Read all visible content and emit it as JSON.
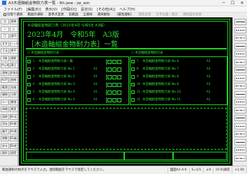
{
  "window": {
    "title": "A3木造軸組金物耐力表一覧 - Rh.jww - jw_win",
    "minimize": "─",
    "maximize": "☐",
    "close": "✕"
  },
  "menu": [
    "ファイル(F)",
    "[編集(E)]",
    "表示(V)",
    "[作図(D)]",
    "設定(S)",
    "[その他(A)]",
    "ヘルプ(H)"
  ],
  "toolbar": {
    "check_label": "切取り選択",
    "items": [
      "範囲外選択",
      "基準点変更",
      "前範囲",
      "全選択",
      "選択解除",
      "〈属性選択〉",
      "属性変更",
      "文字位置・集計",
      "選択図形登録"
    ]
  },
  "left_tools": [
    "点",
    "接線",
    "/",
    "□",
    "〇",
    "接円",
    "文字",
    "ハッチ",
    "寸法",
    "建平",
    "2線",
    "建断",
    "中心線",
    "建立",
    "連線",
    "多角形",
    "AUTO",
    "曲線",
    "範囲",
    "包絡",
    "複線",
    "分割",
    "コーナー",
    "整理",
    "伸縮",
    "属変",
    "面取",
    "BL化",
    "消去",
    "BL解",
    "複写",
    "BL属",
    "移動",
    "BL編",
    "戻る",
    "BL終",
    "図形",
    "図登"
  ],
  "drawing": {
    "header_label": "木造軸組金物耐力表（2023年4月 令和5年 A3版）",
    "main_title_1": "2023年4月　令和5年　A3版",
    "main_title_2": "［木造軸組金物耐力表］一覧",
    "left_table_header": "○ 木造軸組金物耐力表",
    "right_table_header": "○ 木造軸組金物耐力表",
    "left_rows": [
      {
        "num": "1",
        "name": "木造軸組金物耐力表一覧",
        "scale": ""
      },
      {
        "num": "2",
        "name": "木造軸組金物耐力表 No.1",
        "scale": "A3"
      },
      {
        "num": "3",
        "name": "木造軸組金物耐力表 No.2",
        "scale": "A3"
      },
      {
        "num": "4",
        "name": "木造軸組金物耐力表 No.3",
        "scale": "A3"
      },
      {
        "num": "5",
        "name": "木造軸組金物耐力表 No.4",
        "scale": "A3"
      },
      {
        "num": "6",
        "name": "木造軸組金物耐力表 No.5",
        "scale": "A3"
      }
    ],
    "right_rows": [
      {
        "num": "7",
        "name": "木造軸組金物耐力表 No.6",
        "scale": "A3"
      },
      {
        "num": "8",
        "name": "木造軸組金物耐力表 No.7",
        "scale": "A3"
      },
      {
        "num": "9",
        "name": "木造軸組金物耐力表 No.8",
        "scale": "A3"
      },
      {
        "num": "10",
        "name": "木造軸組金物耐力表 No.9",
        "scale": "A3"
      },
      {
        "num": "11",
        "name": "木造軸組金物耐力表 No.10",
        "scale": "A3"
      },
      {
        "num": "12",
        "name": "木造軸組金物耐力表 No.11",
        "scale": "A3"
      }
    ]
  },
  "status": {
    "message": "範囲選択の始点をマウスで入力。連続範囲をマウスで指定してください。",
    "paper": "図面A3 A-0",
    "scale": "S=1/1",
    "angle": "∠0",
    "layer": "[0-0]通常",
    "zoom": "×1.00"
  }
}
